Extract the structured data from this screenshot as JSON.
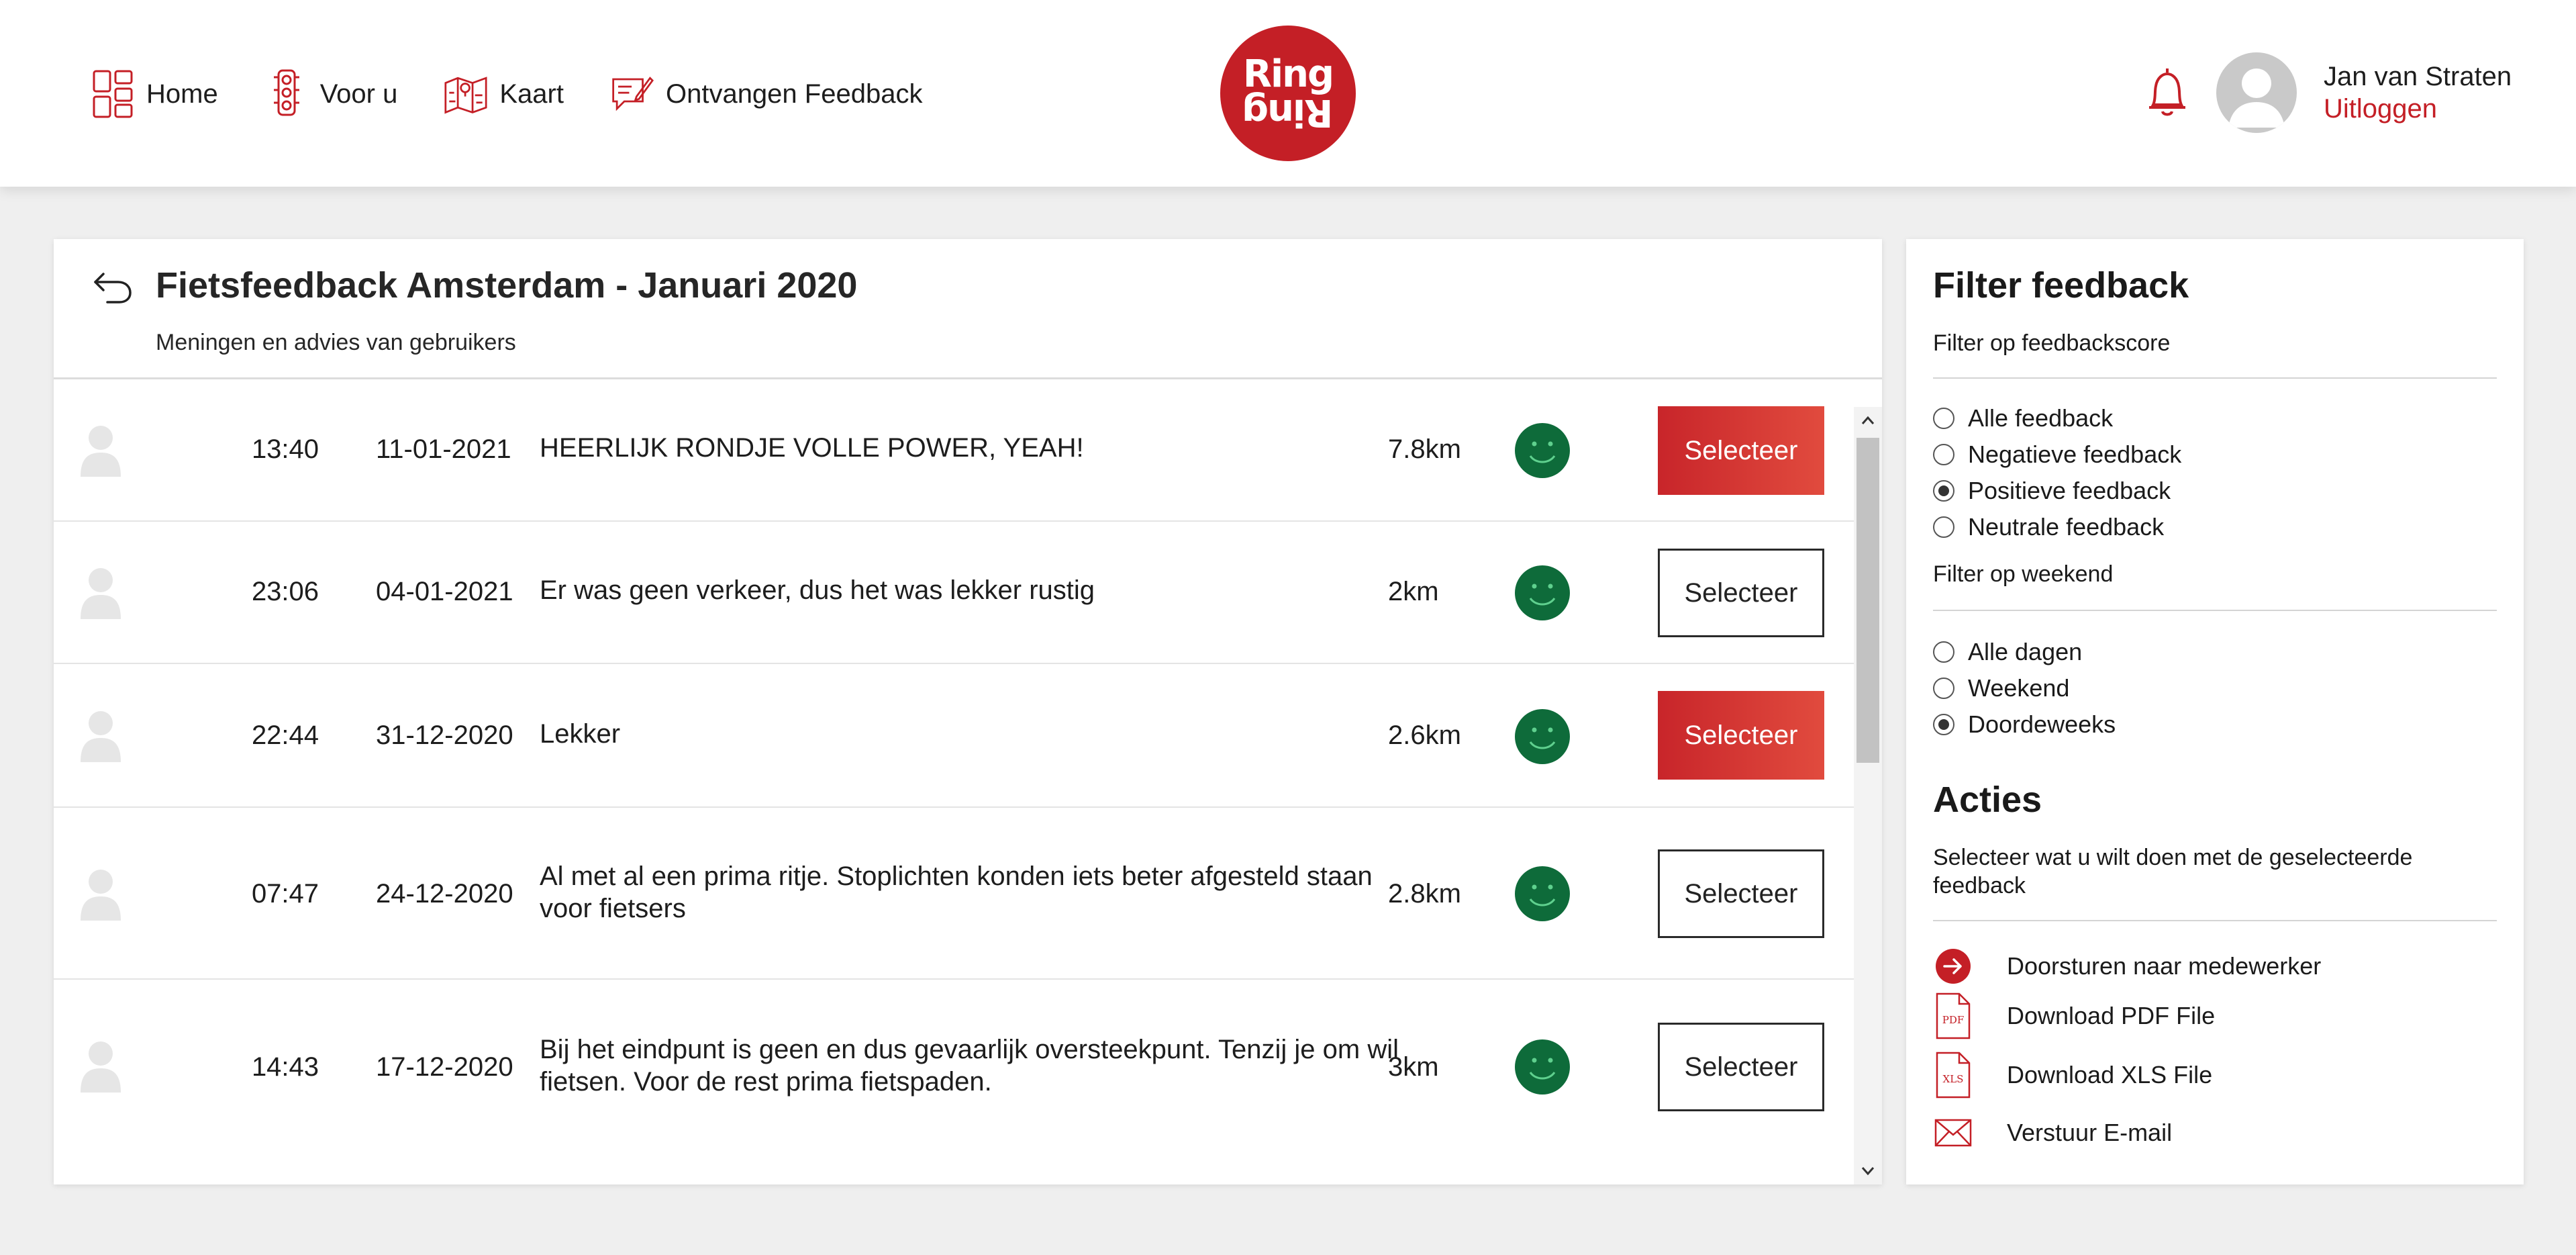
{
  "nav": {
    "items": [
      {
        "label": "Home",
        "icon": "dashboard-icon"
      },
      {
        "label": "Voor u",
        "icon": "traffic-light-icon"
      },
      {
        "label": "Kaart",
        "icon": "map-icon"
      },
      {
        "label": "Ontvangen Feedback",
        "icon": "feedback-icon"
      }
    ]
  },
  "logo": {
    "line1": "Ring",
    "line2": "Ring"
  },
  "user": {
    "name": "Jan van Straten",
    "logout": "Uitloggen"
  },
  "main": {
    "title": "Fietsfeedback Amsterdam - Januari 2020",
    "subtitle": "Meningen en advies van gebruikers",
    "rows": [
      {
        "time": "13:40",
        "date": "11-01-2021",
        "message": "HEERLIJK RONDJE VOLLE POWER, YEAH!",
        "distance": "7.8km",
        "button": "Selecteer",
        "selected": true
      },
      {
        "time": "23:06",
        "date": "04-01-2021",
        "message": "Er was geen verkeer, dus het was lekker rustig",
        "distance": "2km",
        "button": "Selecteer",
        "selected": false
      },
      {
        "time": "22:44",
        "date": "31-12-2020",
        "message": "Lekker",
        "distance": "2.6km",
        "button": "Selecteer",
        "selected": true
      },
      {
        "time": "07:47",
        "date": "24-12-2020",
        "message": "Al met al een prima ritje. Stoplichten konden iets beter afgesteld staan voor fietsers",
        "distance": "2.8km",
        "button": "Selecteer",
        "selected": false
      },
      {
        "time": "14:43",
        "date": "17-12-2020",
        "message": "Bij het eindpunt is geen en dus gevaarlijk oversteekpunt. Tenzij je om wil fietsen. Voor de rest prima fietspaden.",
        "distance": "3km",
        "button": "Selecteer",
        "selected": false
      }
    ]
  },
  "filter": {
    "title": "Filter feedback",
    "score_label": "Filter op feedbackscore",
    "score_options": [
      {
        "label": "Alle feedback",
        "checked": false
      },
      {
        "label": "Negatieve feedback",
        "checked": false
      },
      {
        "label": "Positieve feedback",
        "checked": true
      },
      {
        "label": "Neutrale feedback",
        "checked": false
      }
    ],
    "weekend_label": "Filter op weekend",
    "weekend_options": [
      {
        "label": "Alle dagen",
        "checked": false
      },
      {
        "label": "Weekend",
        "checked": false
      },
      {
        "label": "Doordeweeks",
        "checked": true
      }
    ]
  },
  "actions": {
    "title": "Acties",
    "subtitle": "Selecteer wat u wilt doen met de geselecteerde feedback",
    "items": [
      {
        "label": "Doorsturen naar medewerker",
        "icon": "forward-arrow-icon"
      },
      {
        "label": "Download PDF File",
        "icon": "pdf-file-icon",
        "badge": "PDF"
      },
      {
        "label": "Download XLS File",
        "icon": "xls-file-icon",
        "badge": "XLS"
      },
      {
        "label": "Verstuur E-mail",
        "icon": "envelope-icon"
      }
    ]
  },
  "colors": {
    "accent": "#c41f26",
    "smiley": "#0e6b3a"
  }
}
